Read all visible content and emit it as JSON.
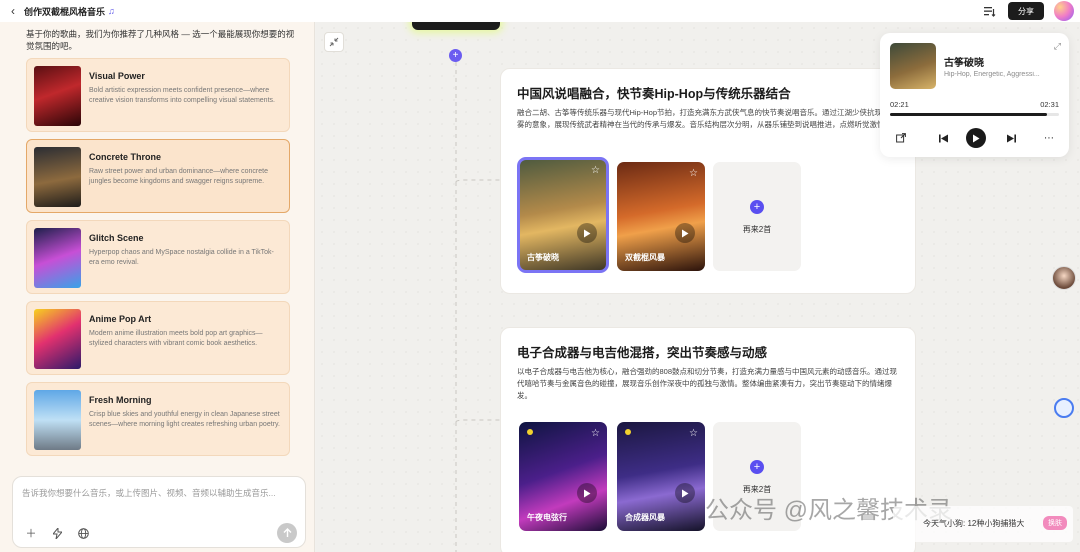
{
  "header": {
    "title": "创作双截棍风格音乐",
    "title_icon": "♫",
    "share_label": "分享"
  },
  "left": {
    "intro": "基于你的歌曲，我们为你推荐了几种风格 — 选一个最能展现你想要的视觉氛围的吧。",
    "cards": [
      {
        "title": "Visual Power",
        "desc": "Bold artistic expression meets confident presence—where creative vision transforms into compelling visual statements."
      },
      {
        "title": "Concrete Throne",
        "desc": "Raw street power and urban dominance—where concrete jungles become kingdoms and swagger reigns supreme."
      },
      {
        "title": "Glitch Scene",
        "desc": "Hyperpop chaos and MySpace nostalgia collide in a TikTok-era emo revival."
      },
      {
        "title": "Anime Pop Art",
        "desc": "Modern anime illustration meets bold pop art graphics—stylized characters with vibrant comic book aesthetics."
      },
      {
        "title": "Fresh Morning",
        "desc": "Crisp blue skies and youthful energy in clean Japanese street scenes—where morning light creates refreshing urban poetry."
      }
    ],
    "input_placeholder": "告诉我你想要什么音乐，或上传图片、视频、音频以辅助生成音乐..."
  },
  "sections": [
    {
      "title": "中国风说唱融合，快节奏Hip-Hop与传统乐器结合",
      "desc": "融合二胡、古筝等传统乐器与现代Hip-Hop节拍，打造充满东方武侠气息的快节奏说唱音乐。通过江湖少侠抗现代迷雾的意象，展现传统武者精神在当代的传承与爆发。音乐结构层次分明，从器乐铺垫到说唱推进，点燃听觉激情。",
      "songs": [
        {
          "name": "古筝破晓"
        },
        {
          "name": "双截棍风暴"
        }
      ],
      "more_label": "再来2首"
    },
    {
      "title": "电子合成器与电吉他混搭，突出节奏感与动感",
      "desc": "以电子合成器与电吉他为核心，融合强劲的808鼓点和切分节奏，打造充满力量感与中国风元素的动感音乐。通过现代嘻哈节奏与金属音色的碰撞，展现音乐创作深夜中的孤独与激情。整体编曲紧凑有力，突出节奏驱动下的情绪爆发。",
      "songs": [
        {
          "name": "午夜电弦行"
        },
        {
          "name": "合成器风暴"
        }
      ],
      "more_label": "再来2首"
    }
  ],
  "player": {
    "title": "古筝破晓",
    "subtitle": "Hip-Hop, Energetic, Aggressi...",
    "current_time": "02:21",
    "total_time": "02:31",
    "progress": 0.93
  },
  "overlay": {
    "watermark": "公众号 @风之馨技术录",
    "ticker_text": "今天气小狗: 12种小狗捕猎大",
    "ticker_tag": "换肤"
  }
}
